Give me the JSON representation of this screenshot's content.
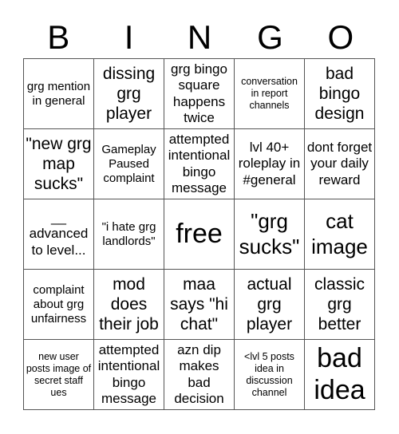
{
  "header": {
    "letters": [
      "B",
      "I",
      "N",
      "G",
      "O"
    ]
  },
  "board": {
    "rows": [
      [
        {
          "text": "grg mention in general",
          "size": "s-s"
        },
        {
          "text": "dissing grg player",
          "size": "s-l"
        },
        {
          "text": "grg bingo square happens twice",
          "size": "s-m"
        },
        {
          "text": "conversation in report channels",
          "size": "s-xs"
        },
        {
          "text": "bad bingo design",
          "size": "s-l"
        }
      ],
      [
        {
          "text": "\"new grg map sucks\"",
          "size": "s-l"
        },
        {
          "text": "Gameplay Paused complaint",
          "size": "s-s"
        },
        {
          "text": "attempted intentional bingo message",
          "size": "s-m"
        },
        {
          "text": "lvl 40+ roleplay in #general",
          "size": "s-m"
        },
        {
          "text": "dont forget your daily reward",
          "size": "s-m"
        }
      ],
      [
        {
          "text": "__ advanced to level...",
          "size": "s-m"
        },
        {
          "text": "\"i hate grg landlords\"",
          "size": "s-s"
        },
        {
          "text": "free",
          "size": "s-xxl"
        },
        {
          "text": "\"grg sucks\"",
          "size": "s-xl"
        },
        {
          "text": "cat image",
          "size": "s-xl"
        }
      ],
      [
        {
          "text": "complaint about grg unfairness",
          "size": "s-s"
        },
        {
          "text": "mod does their job",
          "size": "s-l"
        },
        {
          "text": "maa says \"hi chat\"",
          "size": "s-l"
        },
        {
          "text": "actual grg player",
          "size": "s-l"
        },
        {
          "text": "classic grg better",
          "size": "s-l"
        }
      ],
      [
        {
          "text": "new user posts image of secret staff ues",
          "size": "s-xs"
        },
        {
          "text": "attempted intentional bingo message",
          "size": "s-m"
        },
        {
          "text": "azn dip makes bad decision",
          "size": "s-m"
        },
        {
          "text": "<lvl 5 posts idea in discussion channel",
          "size": "s-xs"
        },
        {
          "text": "bad idea",
          "size": "s-xxl"
        }
      ]
    ]
  }
}
